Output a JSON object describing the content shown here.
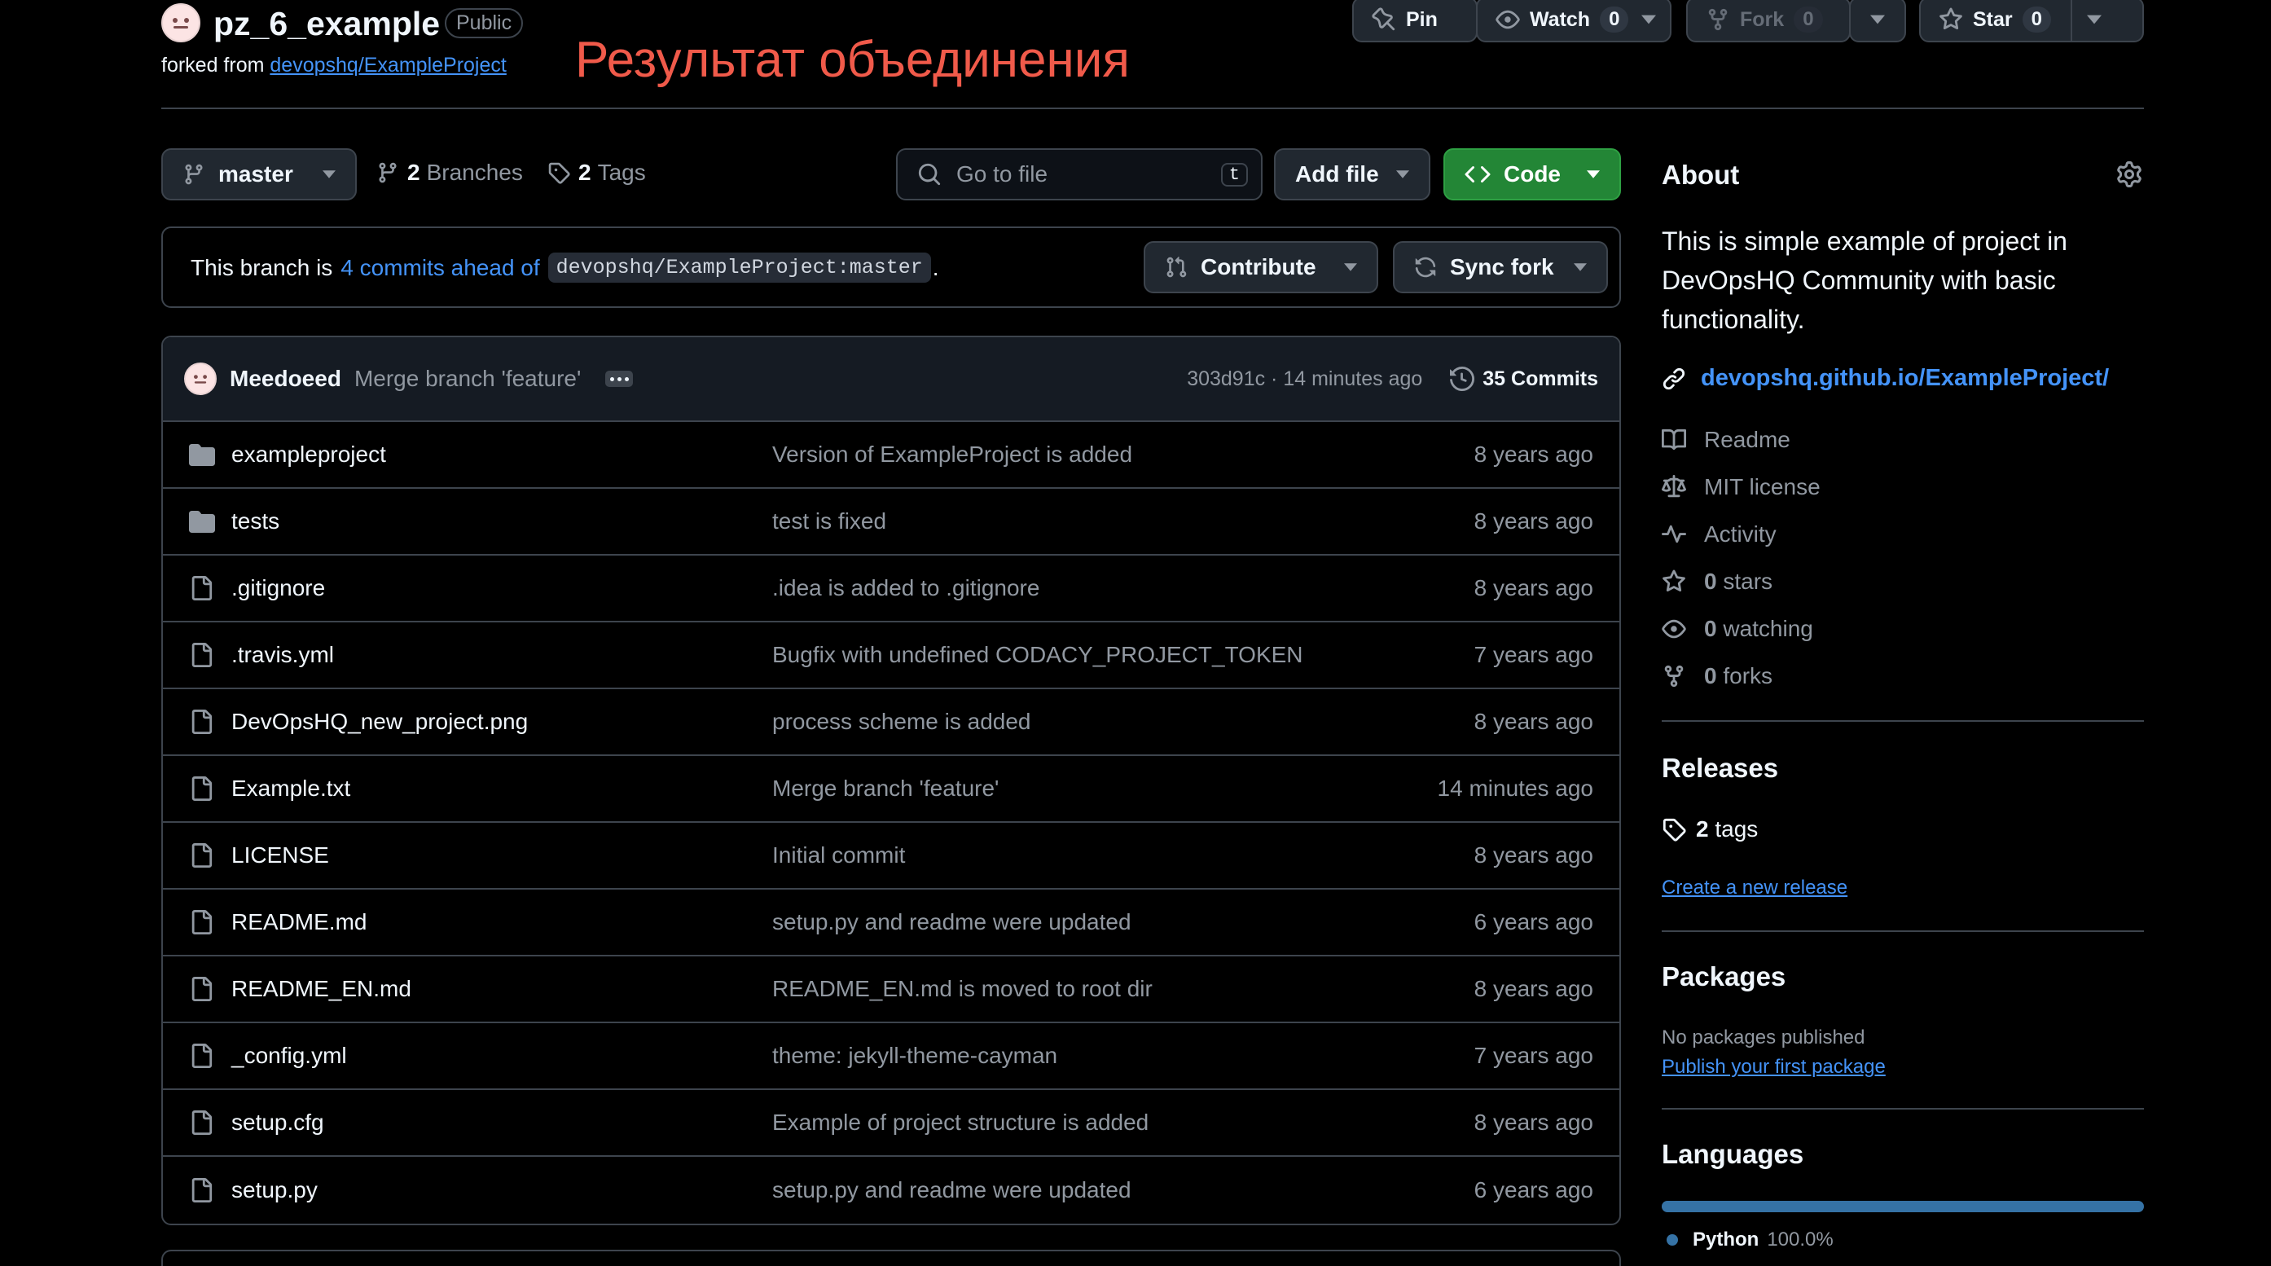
{
  "repo": {
    "name": "pz_6_example",
    "visibility": "Public",
    "forked_prefix": "forked from",
    "forked_from": "devopshq/ExampleProject",
    "annotation": "Результат объединения"
  },
  "header_actions": {
    "pin_label": "Pin",
    "watch_label": "Watch",
    "watch_count": "0",
    "fork_label": "Fork",
    "fork_count": "0",
    "star_label": "Star",
    "star_count": "0"
  },
  "toolbar": {
    "branch": "master",
    "branches_count": "2",
    "branches_label": "Branches",
    "tags_count": "2",
    "tags_label": "Tags",
    "search_placeholder": "Go to file",
    "search_shortcut": "t",
    "add_file_label": "Add file",
    "code_label": "Code"
  },
  "ahead": {
    "prefix": "This branch is",
    "link": "4 commits ahead of",
    "ref": "devopshq/ExampleProject:master",
    "suffix": ".",
    "contribute_label": "Contribute",
    "sync_label": "Sync fork"
  },
  "latest_commit": {
    "author": "Meedoeed",
    "message": "Merge branch 'feature'",
    "meta": "303d91c · 14 minutes ago",
    "commits_label": "35 Commits"
  },
  "files": [
    {
      "type": "folder",
      "name": "exampleproject",
      "message": "Version of ExampleProject is added",
      "date": "8 years ago"
    },
    {
      "type": "folder",
      "name": "tests",
      "message": "test is fixed",
      "date": "8 years ago"
    },
    {
      "type": "file",
      "name": ".gitignore",
      "message": ".idea is added to .gitignore",
      "date": "8 years ago"
    },
    {
      "type": "file",
      "name": ".travis.yml",
      "message": "Bugfix with undefined CODACY_PROJECT_TOKEN",
      "date": "7 years ago"
    },
    {
      "type": "file",
      "name": "DevOpsHQ_new_project.png",
      "message": "process scheme is added",
      "date": "8 years ago"
    },
    {
      "type": "file",
      "name": "Example.txt",
      "message": "Merge branch 'feature'",
      "date": "14 minutes ago"
    },
    {
      "type": "file",
      "name": "LICENSE",
      "message": "Initial commit",
      "date": "8 years ago"
    },
    {
      "type": "file",
      "name": "README.md",
      "message": "setup.py and readme were updated",
      "date": "6 years ago"
    },
    {
      "type": "file",
      "name": "README_EN.md",
      "message": "README_EN.md is moved to root dir",
      "date": "8 years ago"
    },
    {
      "type": "file",
      "name": "_config.yml",
      "message": "theme: jekyll-theme-cayman",
      "date": "7 years ago"
    },
    {
      "type": "file",
      "name": "setup.cfg",
      "message": "Example of project structure is added",
      "date": "8 years ago"
    },
    {
      "type": "file",
      "name": "setup.py",
      "message": "setup.py and readme were updated",
      "date": "6 years ago"
    }
  ],
  "about": {
    "heading": "About",
    "description": "This is simple example of project in DevOpsHQ Community with basic functionality.",
    "website": "devopshq.github.io/ExampleProject/",
    "readme": "Readme",
    "license": "MIT license",
    "activity": "Activity",
    "stars_count": "0",
    "stars_label": "stars",
    "watching_count": "0",
    "watching_label": "watching",
    "forks_count": "0",
    "forks_label": "forks"
  },
  "releases": {
    "heading": "Releases",
    "tags_count": "2",
    "tags_label": "tags",
    "create_link": "Create a new release"
  },
  "packages": {
    "heading": "Packages",
    "none_text": "No packages published",
    "publish_link": "Publish your first package"
  },
  "languages": {
    "heading": "Languages",
    "items": [
      {
        "name": "Python",
        "percent": "100.0%",
        "color": "#3572a5"
      }
    ]
  }
}
